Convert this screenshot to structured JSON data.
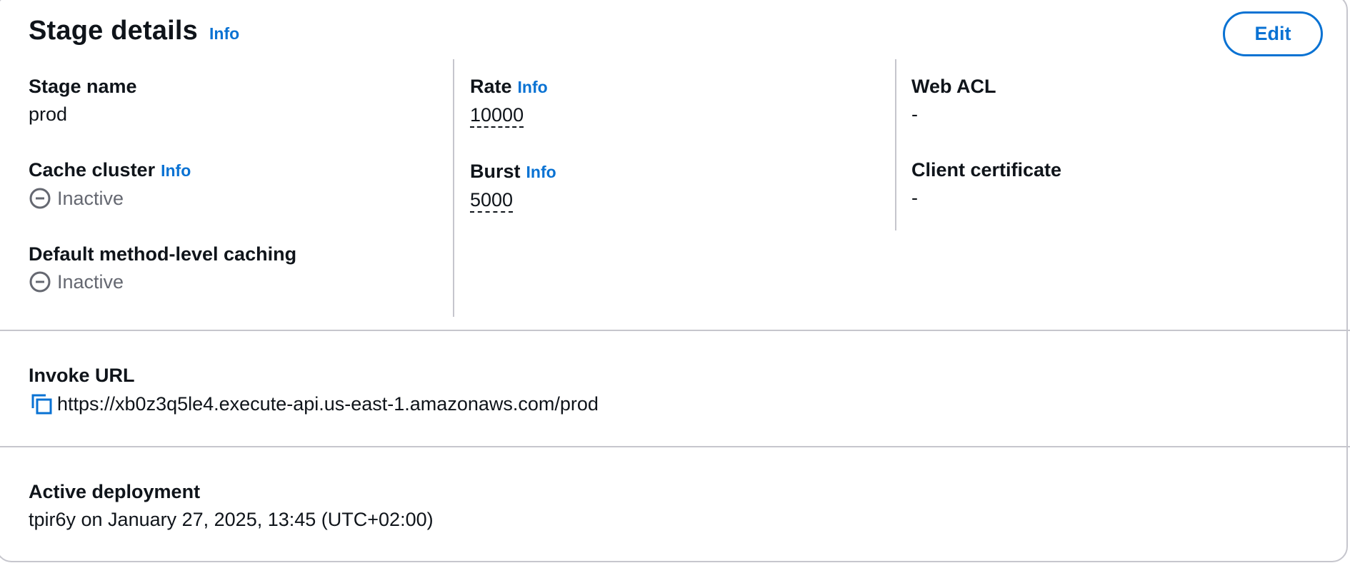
{
  "header": {
    "title": "Stage details",
    "info_label": "Info",
    "edit_label": "Edit"
  },
  "column1": {
    "stage_name": {
      "label": "Stage name",
      "value": "prod"
    },
    "cache_cluster": {
      "label": "Cache cluster",
      "info_label": "Info",
      "value": "Inactive",
      "status_icon": "minus-circle-icon"
    },
    "default_caching": {
      "label": "Default method-level caching",
      "value": "Inactive",
      "status_icon": "minus-circle-icon"
    }
  },
  "column2": {
    "rate": {
      "label": "Rate",
      "info_label": "Info",
      "value": "10000"
    },
    "burst": {
      "label": "Burst",
      "info_label": "Info",
      "value": "5000"
    }
  },
  "column3": {
    "web_acl": {
      "label": "Web ACL",
      "value": "-"
    },
    "client_certificate": {
      "label": "Client certificate",
      "value": "-"
    }
  },
  "invoke_url": {
    "label": "Invoke URL",
    "value": "https://xb0z3q5le4.execute-api.us-east-1.amazonaws.com/prod",
    "icon": "copy-icon"
  },
  "active_deployment": {
    "label": "Active deployment",
    "value": "tpir6y on January 27, 2025, 13:45 (UTC+02:00)"
  },
  "colors": {
    "link": "#0972d3",
    "text": "#0f141a",
    "muted": "#656871",
    "divider": "#c6c6cd"
  }
}
